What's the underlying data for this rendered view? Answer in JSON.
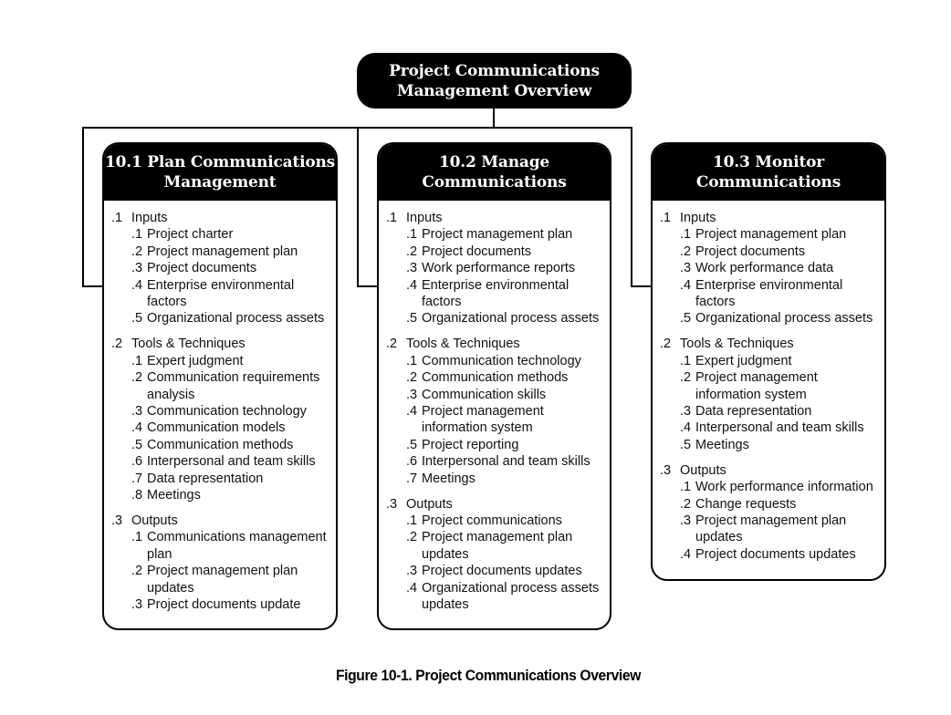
{
  "overview": {
    "title_line1": "Project Communications",
    "title_line2": "Management Overview"
  },
  "processes": [
    {
      "title_line1": "10.1 Plan Communications",
      "title_line2": "Management",
      "sections": [
        {
          "num": ".1",
          "label": "Inputs",
          "items": [
            {
              "num": ".1",
              "text": "Project charter"
            },
            {
              "num": ".2",
              "text": "Project management plan"
            },
            {
              "num": ".3",
              "text": "Project documents"
            },
            {
              "num": ".4",
              "text": "Enterprise environmental\nfactors"
            },
            {
              "num": ".5",
              "text": "Organizational process assets"
            }
          ]
        },
        {
          "num": ".2",
          "label": "Tools & Techniques",
          "items": [
            {
              "num": ".1",
              "text": "Expert judgment"
            },
            {
              "num": ".2",
              "text": "Communication requirements\nanalysis"
            },
            {
              "num": ".3",
              "text": "Communication technology"
            },
            {
              "num": ".4",
              "text": "Communication models"
            },
            {
              "num": ".5",
              "text": "Communication methods"
            },
            {
              "num": ".6",
              "text": "Interpersonal and team skills"
            },
            {
              "num": ".7",
              "text": "Data representation"
            },
            {
              "num": ".8",
              "text": "Meetings"
            }
          ]
        },
        {
          "num": ".3",
          "label": "Outputs",
          "items": [
            {
              "num": ".1",
              "text": "Communications management\nplan"
            },
            {
              "num": ".2",
              "text": "Project management plan\nupdates"
            },
            {
              "num": ".3",
              "text": "Project documents update"
            }
          ]
        }
      ]
    },
    {
      "title_line1": "10.2 Manage",
      "title_line2": "Communications",
      "sections": [
        {
          "num": ".1",
          "label": "Inputs",
          "items": [
            {
              "num": ".1",
              "text": "Project management plan"
            },
            {
              "num": ".2",
              "text": "Project documents"
            },
            {
              "num": ".3",
              "text": "Work performance reports"
            },
            {
              "num": ".4",
              "text": "Enterprise environmental\nfactors"
            },
            {
              "num": ".5",
              "text": "Organizational process assets"
            }
          ]
        },
        {
          "num": ".2",
          "label": "Tools & Techniques",
          "items": [
            {
              "num": ".1",
              "text": "Communication technology"
            },
            {
              "num": ".2",
              "text": "Communication methods"
            },
            {
              "num": ".3",
              "text": "Communication skills"
            },
            {
              "num": ".4",
              "text": "Project management\ninformation system"
            },
            {
              "num": ".5",
              "text": "Project reporting"
            },
            {
              "num": ".6",
              "text": "Interpersonal and team skills"
            },
            {
              "num": ".7",
              "text": "Meetings"
            }
          ]
        },
        {
          "num": ".3",
          "label": "Outputs",
          "items": [
            {
              "num": ".1",
              "text": "Project communications"
            },
            {
              "num": ".2",
              "text": "Project management plan\nupdates"
            },
            {
              "num": ".3",
              "text": "Project documents updates"
            },
            {
              "num": ".4",
              "text": "Organizational process assets\nupdates"
            }
          ]
        }
      ]
    },
    {
      "title_line1": "10.3 Monitor",
      "title_line2": "Communications",
      "sections": [
        {
          "num": ".1",
          "label": "Inputs",
          "items": [
            {
              "num": ".1",
              "text": "Project management plan"
            },
            {
              "num": ".2",
              "text": "Project documents"
            },
            {
              "num": ".3",
              "text": "Work performance data"
            },
            {
              "num": ".4",
              "text": "Enterprise environmental\nfactors"
            },
            {
              "num": ".5",
              "text": "Organizational process assets"
            }
          ]
        },
        {
          "num": ".2",
          "label": "Tools & Techniques",
          "items": [
            {
              "num": ".1",
              "text": "Expert judgment"
            },
            {
              "num": ".2",
              "text": "Project management\ninformation system"
            },
            {
              "num": ".3",
              "text": "Data representation"
            },
            {
              "num": ".4",
              "text": "Interpersonal and team skills"
            },
            {
              "num": ".5",
              "text": "Meetings"
            }
          ]
        },
        {
          "num": ".3",
          "label": "Outputs",
          "items": [
            {
              "num": ".1",
              "text": "Work performance information"
            },
            {
              "num": ".2",
              "text": "Change requests"
            },
            {
              "num": ".3",
              "text": "Project management plan\nupdates"
            },
            {
              "num": ".4",
              "text": "Project documents updates"
            }
          ]
        }
      ]
    }
  ],
  "caption": "Figure 10-1. Project Communications Overview"
}
